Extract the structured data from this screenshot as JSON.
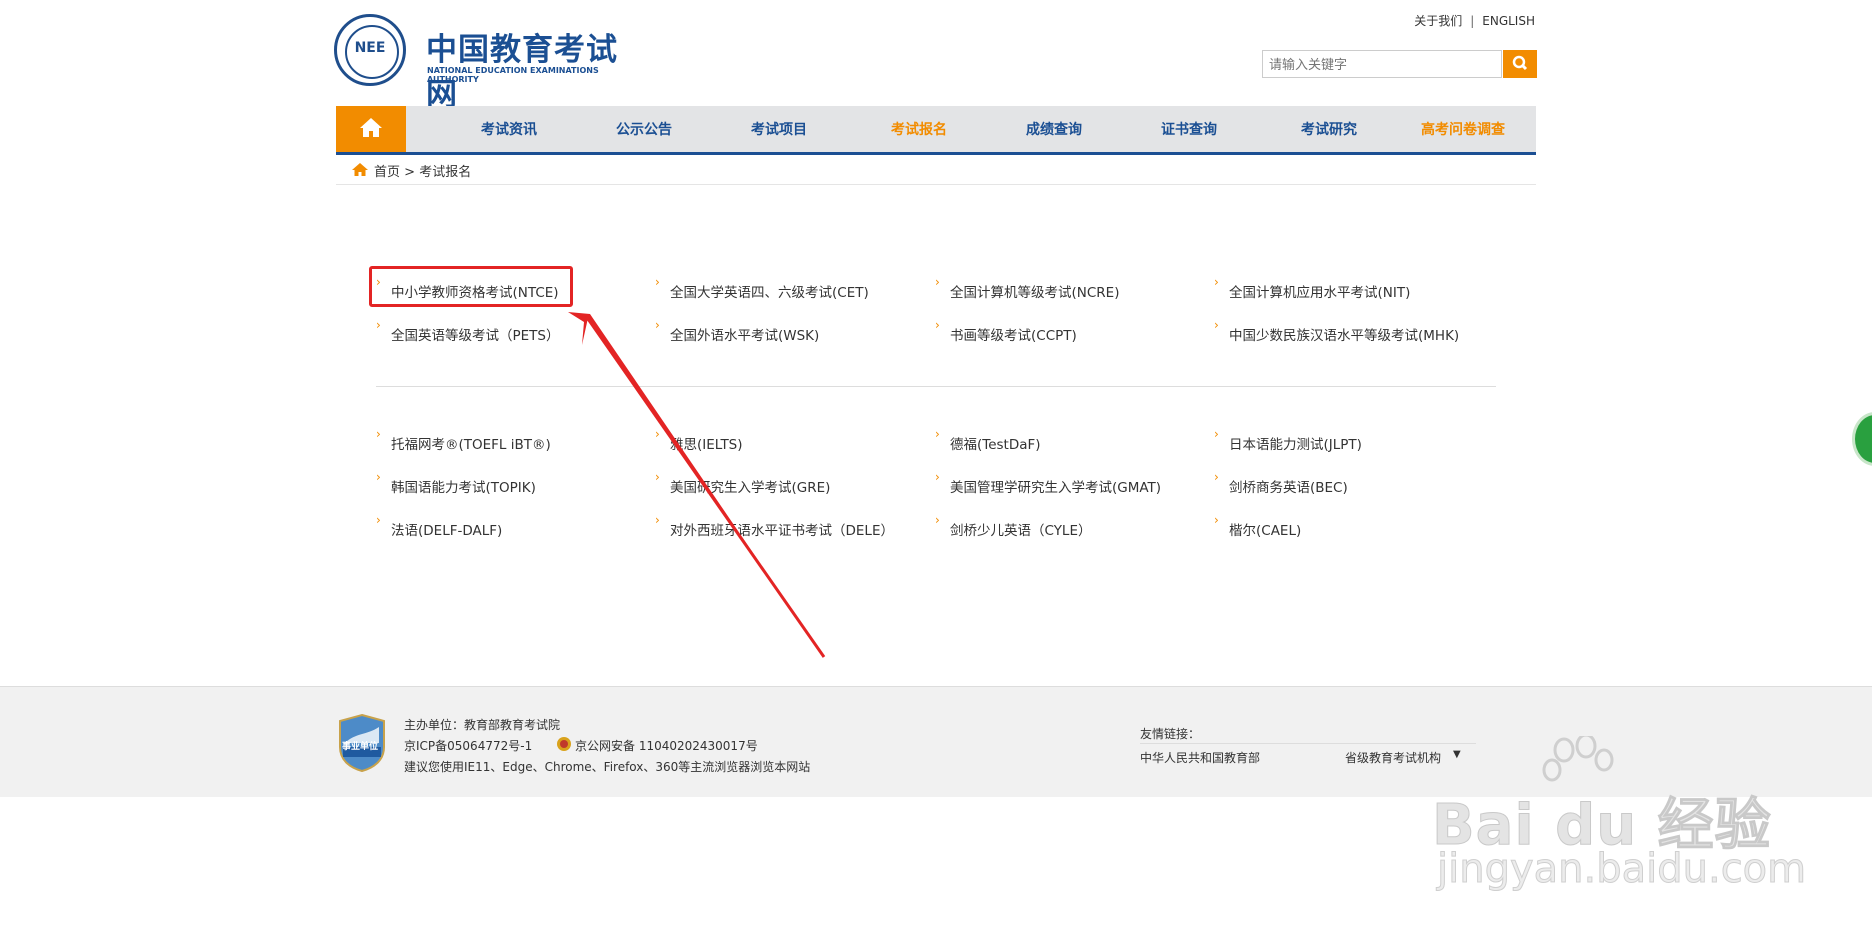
{
  "header": {
    "logo_cn": "中国教育考试网",
    "logo_en": "NATIONAL EDUCATION EXAMINATIONS AUTHORITY",
    "logo_mark": "NEE",
    "top_links": [
      "关于我们",
      "ENGLISH"
    ],
    "search_placeholder": "请输入关键字"
  },
  "nav": {
    "items": [
      "考试资讯",
      "公示公告",
      "考试项目",
      "考试报名",
      "成绩查询",
      "证书查询",
      "考试研究",
      "高考问卷调查"
    ],
    "active": "考试报名"
  },
  "breadcrumb": {
    "home": "首页",
    "separator": ">",
    "current": "考试报名"
  },
  "exams_domestic": [
    "中小学教师资格考试(NTCE)",
    "全国大学英语四、六级考试(CET)",
    "全国计算机等级考试(NCRE)",
    "全国计算机应用水平考试(NIT)",
    "全国英语等级考试（PETS）",
    "全国外语水平考试(WSK)",
    "书画等级考试(CCPT)",
    "中国少数民族汉语水平等级考试(MHK)"
  ],
  "exams_foreign": [
    "托福网考®(TOEFL iBT®)",
    "雅思(IELTS)",
    "德福(TestDaF)",
    "日本语能力测试(JLPT)",
    "韩国语能力考试(TOPIK)",
    "美国研究生入学考试(GRE)",
    "美国管理学研究生入学考试(GMAT)",
    "剑桥商务英语(BEC)",
    "法语(DELF-DALF)",
    "对外西班牙语水平证书考试（DELE）",
    "剑桥少儿英语（CYLE）",
    "楷尔(CAEL)"
  ],
  "footer": {
    "host": "主办单位：教育部教育考试院",
    "icp": "京ICP备05064772号-1",
    "security": "京公网安备 11040202430017号",
    "browser_note": "建议您使用IE11、Edge、Chrome、Firefox、360等主流浏览器浏览本网站",
    "badge_text": "事业单位",
    "friend_title": "友情链接：",
    "friend_links": [
      "中华人民共和国教育部",
      "省级教育考试机构"
    ]
  },
  "watermark": {
    "brand": "Bai du 经验",
    "domain": "jingyan.baidu.com"
  },
  "colors": {
    "brand_blue": "#1b4f93",
    "accent_orange": "#f28c00",
    "highlight_red": "#e32424"
  }
}
